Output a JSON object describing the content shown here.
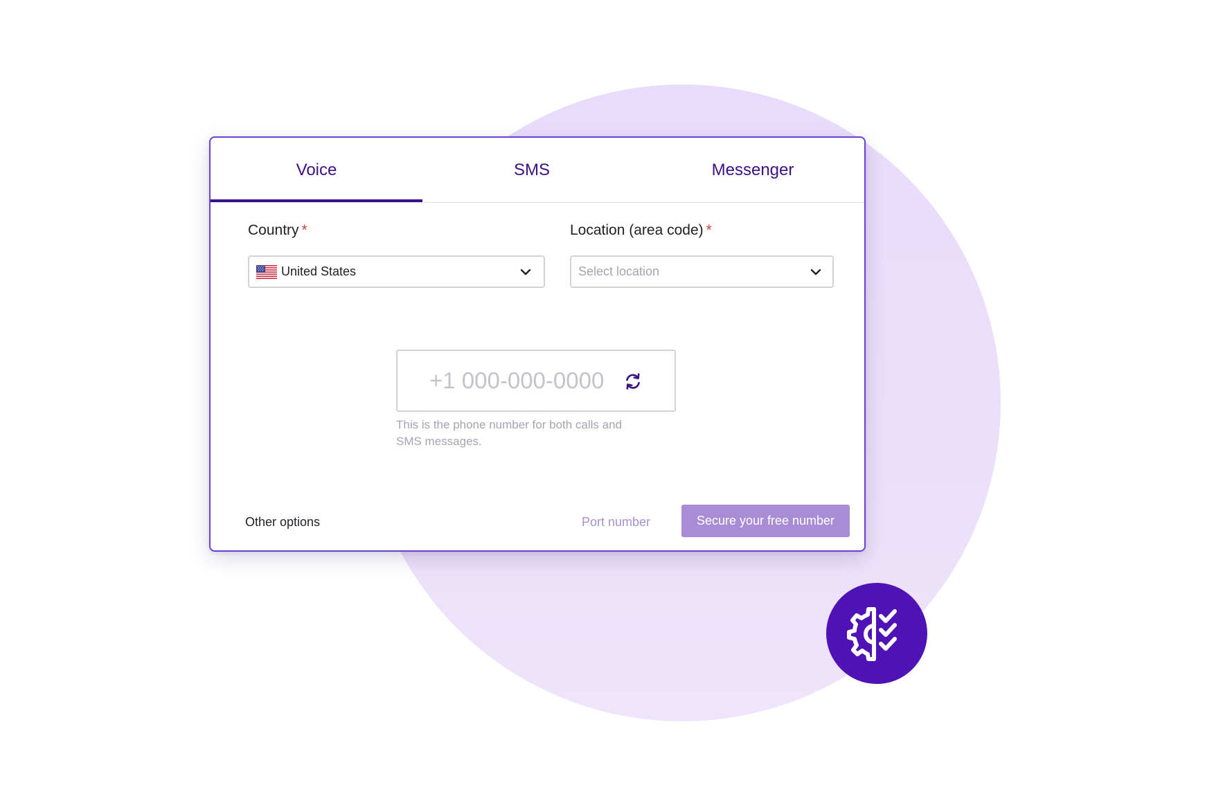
{
  "tabs": [
    {
      "label": "Voice",
      "active": true
    },
    {
      "label": "SMS",
      "active": false
    },
    {
      "label": "Messenger",
      "active": false
    }
  ],
  "form": {
    "country": {
      "label": "Country",
      "required_mark": "*",
      "value": "United States",
      "flag_icon": "us-flag-icon"
    },
    "location": {
      "label": "Location (area code)",
      "required_mark": "*",
      "placeholder": "Select location"
    },
    "phone": {
      "value": "+1 000-000-0000",
      "helper_line1": "This is the phone number for both calls and",
      "helper_line2": "SMS messages."
    }
  },
  "footer": {
    "other_options": "Other options",
    "port_number": "Port number",
    "secure_button": "Secure your free number"
  },
  "badge": {
    "icon": "gear-checklist-icon"
  },
  "colors": {
    "primary": "#3b1186",
    "border": "#6a3fd6",
    "button": "#a98cd6",
    "badge": "#4e12b6",
    "required": "#d93a3a",
    "background_circle": "#ebdffa"
  }
}
